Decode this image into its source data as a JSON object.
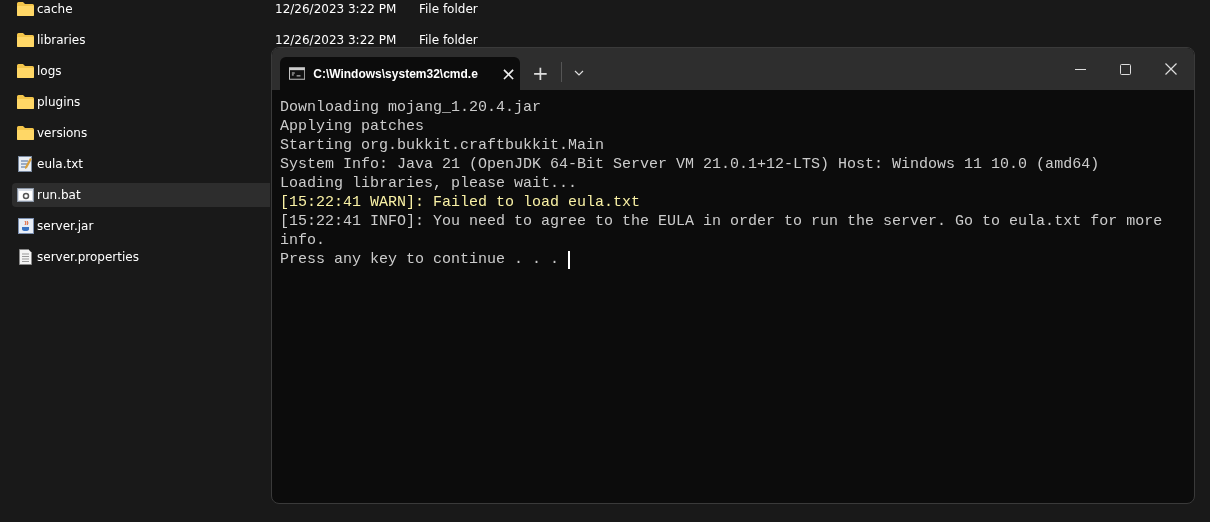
{
  "explorer": {
    "files": [
      {
        "name": "cache",
        "kind": "folder",
        "date": "12/26/2023 3:22 PM",
        "type": "File folder",
        "selected": false
      },
      {
        "name": "libraries",
        "kind": "folder",
        "date": "12/26/2023 3:22 PM",
        "type": "File folder",
        "selected": false
      },
      {
        "name": "logs",
        "kind": "folder",
        "selected": false
      },
      {
        "name": "plugins",
        "kind": "folder",
        "selected": false
      },
      {
        "name": "versions",
        "kind": "folder",
        "selected": false
      },
      {
        "name": "eula.txt",
        "kind": "text",
        "selected": false
      },
      {
        "name": "run.bat",
        "kind": "batch",
        "selected": true
      },
      {
        "name": "server.jar",
        "kind": "jar",
        "selected": false
      },
      {
        "name": "server.properties",
        "kind": "file",
        "selected": false
      }
    ]
  },
  "terminal": {
    "tab": {
      "title": "C:\\Windows\\system32\\cmd.e",
      "close": "×"
    },
    "new_tab": "+",
    "lines": [
      {
        "text": "Downloading mojang_1.20.4.jar",
        "kind": "plain"
      },
      {
        "text": "Applying patches",
        "kind": "plain"
      },
      {
        "text": "Starting org.bukkit.craftbukkit.Main",
        "kind": "plain"
      },
      {
        "text": "System Info: Java 21 (OpenJDK 64-Bit Server VM 21.0.1+12-LTS) Host: Windows 11 10.0 (amd64)",
        "kind": "plain"
      },
      {
        "text": "Loading libraries, please wait...",
        "kind": "plain"
      },
      {
        "text": "[15:22:41 WARN]: Failed to load eula.txt",
        "kind": "warn"
      },
      {
        "text": "[15:22:41 INFO]: You need to agree to the EULA in order to run the server. Go to eula.txt for more info.",
        "kind": "plain"
      },
      {
        "text": "Press any key to continue . . . ",
        "kind": "prompt"
      }
    ]
  }
}
